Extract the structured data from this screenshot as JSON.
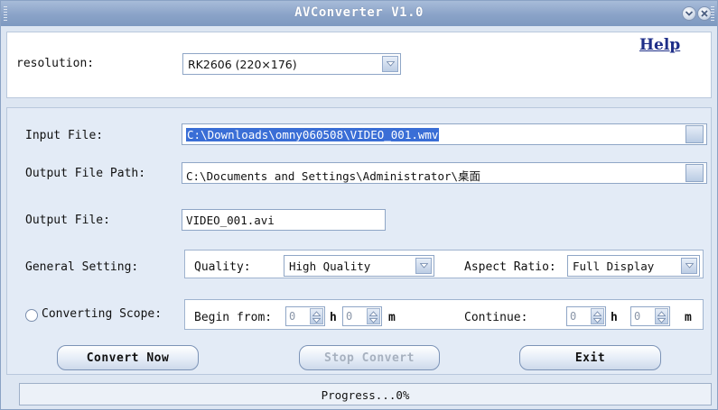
{
  "window": {
    "title": "AVConverter V1.0"
  },
  "top": {
    "resolution_label": "resolution:",
    "resolution_value": "RK2606 (220×176)",
    "help_label": "Help"
  },
  "fields": {
    "input_label": "Input File:",
    "input_value": "C:\\Downloads\\omny060508\\VIDEO_001.wmv",
    "output_path_label": "Output File Path:",
    "output_path_value": "C:\\Documents and Settings\\Administrator\\桌面",
    "output_file_label": "Output File:",
    "output_file_value": "VIDEO_001.avi"
  },
  "general": {
    "label": "General Setting:",
    "quality_label": "Quality:",
    "quality_value": "High Quality",
    "aspect_label": "Aspect Ratio:",
    "aspect_value": "Full Display"
  },
  "scope": {
    "label": "Converting Scope:",
    "begin_label": "Begin from:",
    "begin_h": "0",
    "h_unit": "h",
    "begin_m": "0",
    "m_unit": "m",
    "continue_label": "Continue:",
    "cont_h": "0",
    "cont_m": "0"
  },
  "buttons": {
    "convert": "Convert Now",
    "stop": "Stop Convert",
    "exit": "Exit"
  },
  "status": {
    "progress_text": "Progress...0%",
    "progress_fraction": 0
  },
  "colors": {
    "title_bar": "#8aa3c8",
    "panel": "#e3ebf6",
    "selection": "#3a6ed6",
    "link": "#1f2f88"
  }
}
